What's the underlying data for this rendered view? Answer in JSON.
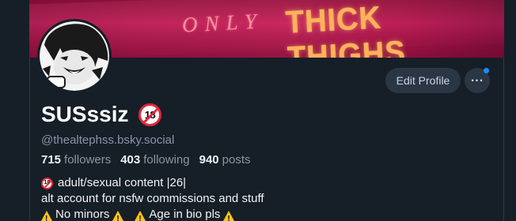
{
  "banner": {
    "text_light": "ONLY",
    "text_bold": "THICK THIGHS"
  },
  "profile": {
    "display_name": "SUSssiz",
    "badge": "18",
    "handle": "@thealtephss.bsky.social",
    "stats": {
      "followers_count": "715",
      "followers_label": "followers",
      "following_count": "403",
      "following_label": "following",
      "posts_count": "940",
      "posts_label": "posts"
    },
    "bio": {
      "line1": "adult/sexual content |26|",
      "line2": "alt account for nsfw commissions and stuff",
      "line3_a": "No minors",
      "line3_b": "Age in bio pls"
    }
  },
  "actions": {
    "edit_profile_label": "Edit Profile",
    "more_label": "..."
  },
  "colors": {
    "background": "#161e27",
    "button_bg": "#2a3644",
    "accent_blue": "#1d8cf8",
    "banner_pink": "#c22058",
    "banner_text": "#ffb25a"
  }
}
